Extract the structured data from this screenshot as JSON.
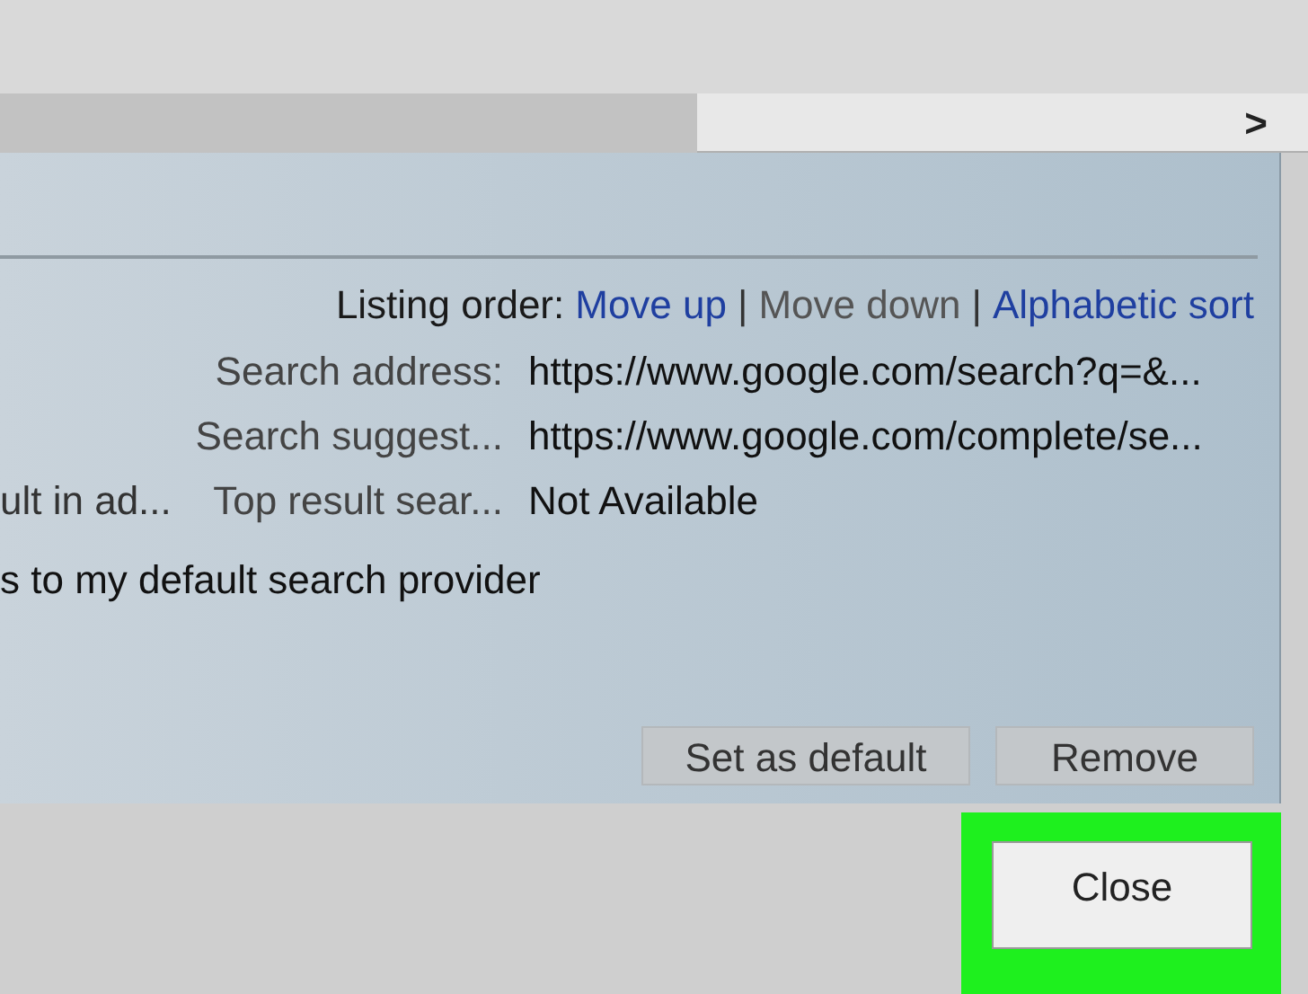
{
  "scrollbar": {
    "arrow": ">"
  },
  "listing_order": {
    "label": "Listing order:",
    "links": [
      {
        "text": "Move up",
        "disabled": false
      },
      {
        "text": "Move down",
        "disabled": true
      },
      {
        "text": "Alphabetic sort",
        "disabled": false
      }
    ],
    "separator": "|"
  },
  "fields": [
    {
      "label": "Search address:",
      "value": "https://www.google.com/search?q=&..."
    },
    {
      "label": "Search suggest...",
      "value": "https://www.google.com/complete/se..."
    },
    {
      "column_1": "ult in ad...",
      "label": "Top result sear...",
      "value": "Not Available"
    }
  ],
  "option_text": "s to my default search provider",
  "buttons": [
    {
      "label": "Set as default"
    },
    {
      "label": "Remove"
    }
  ],
  "close_button": {
    "label": "Close",
    "highlighted": true
  }
}
